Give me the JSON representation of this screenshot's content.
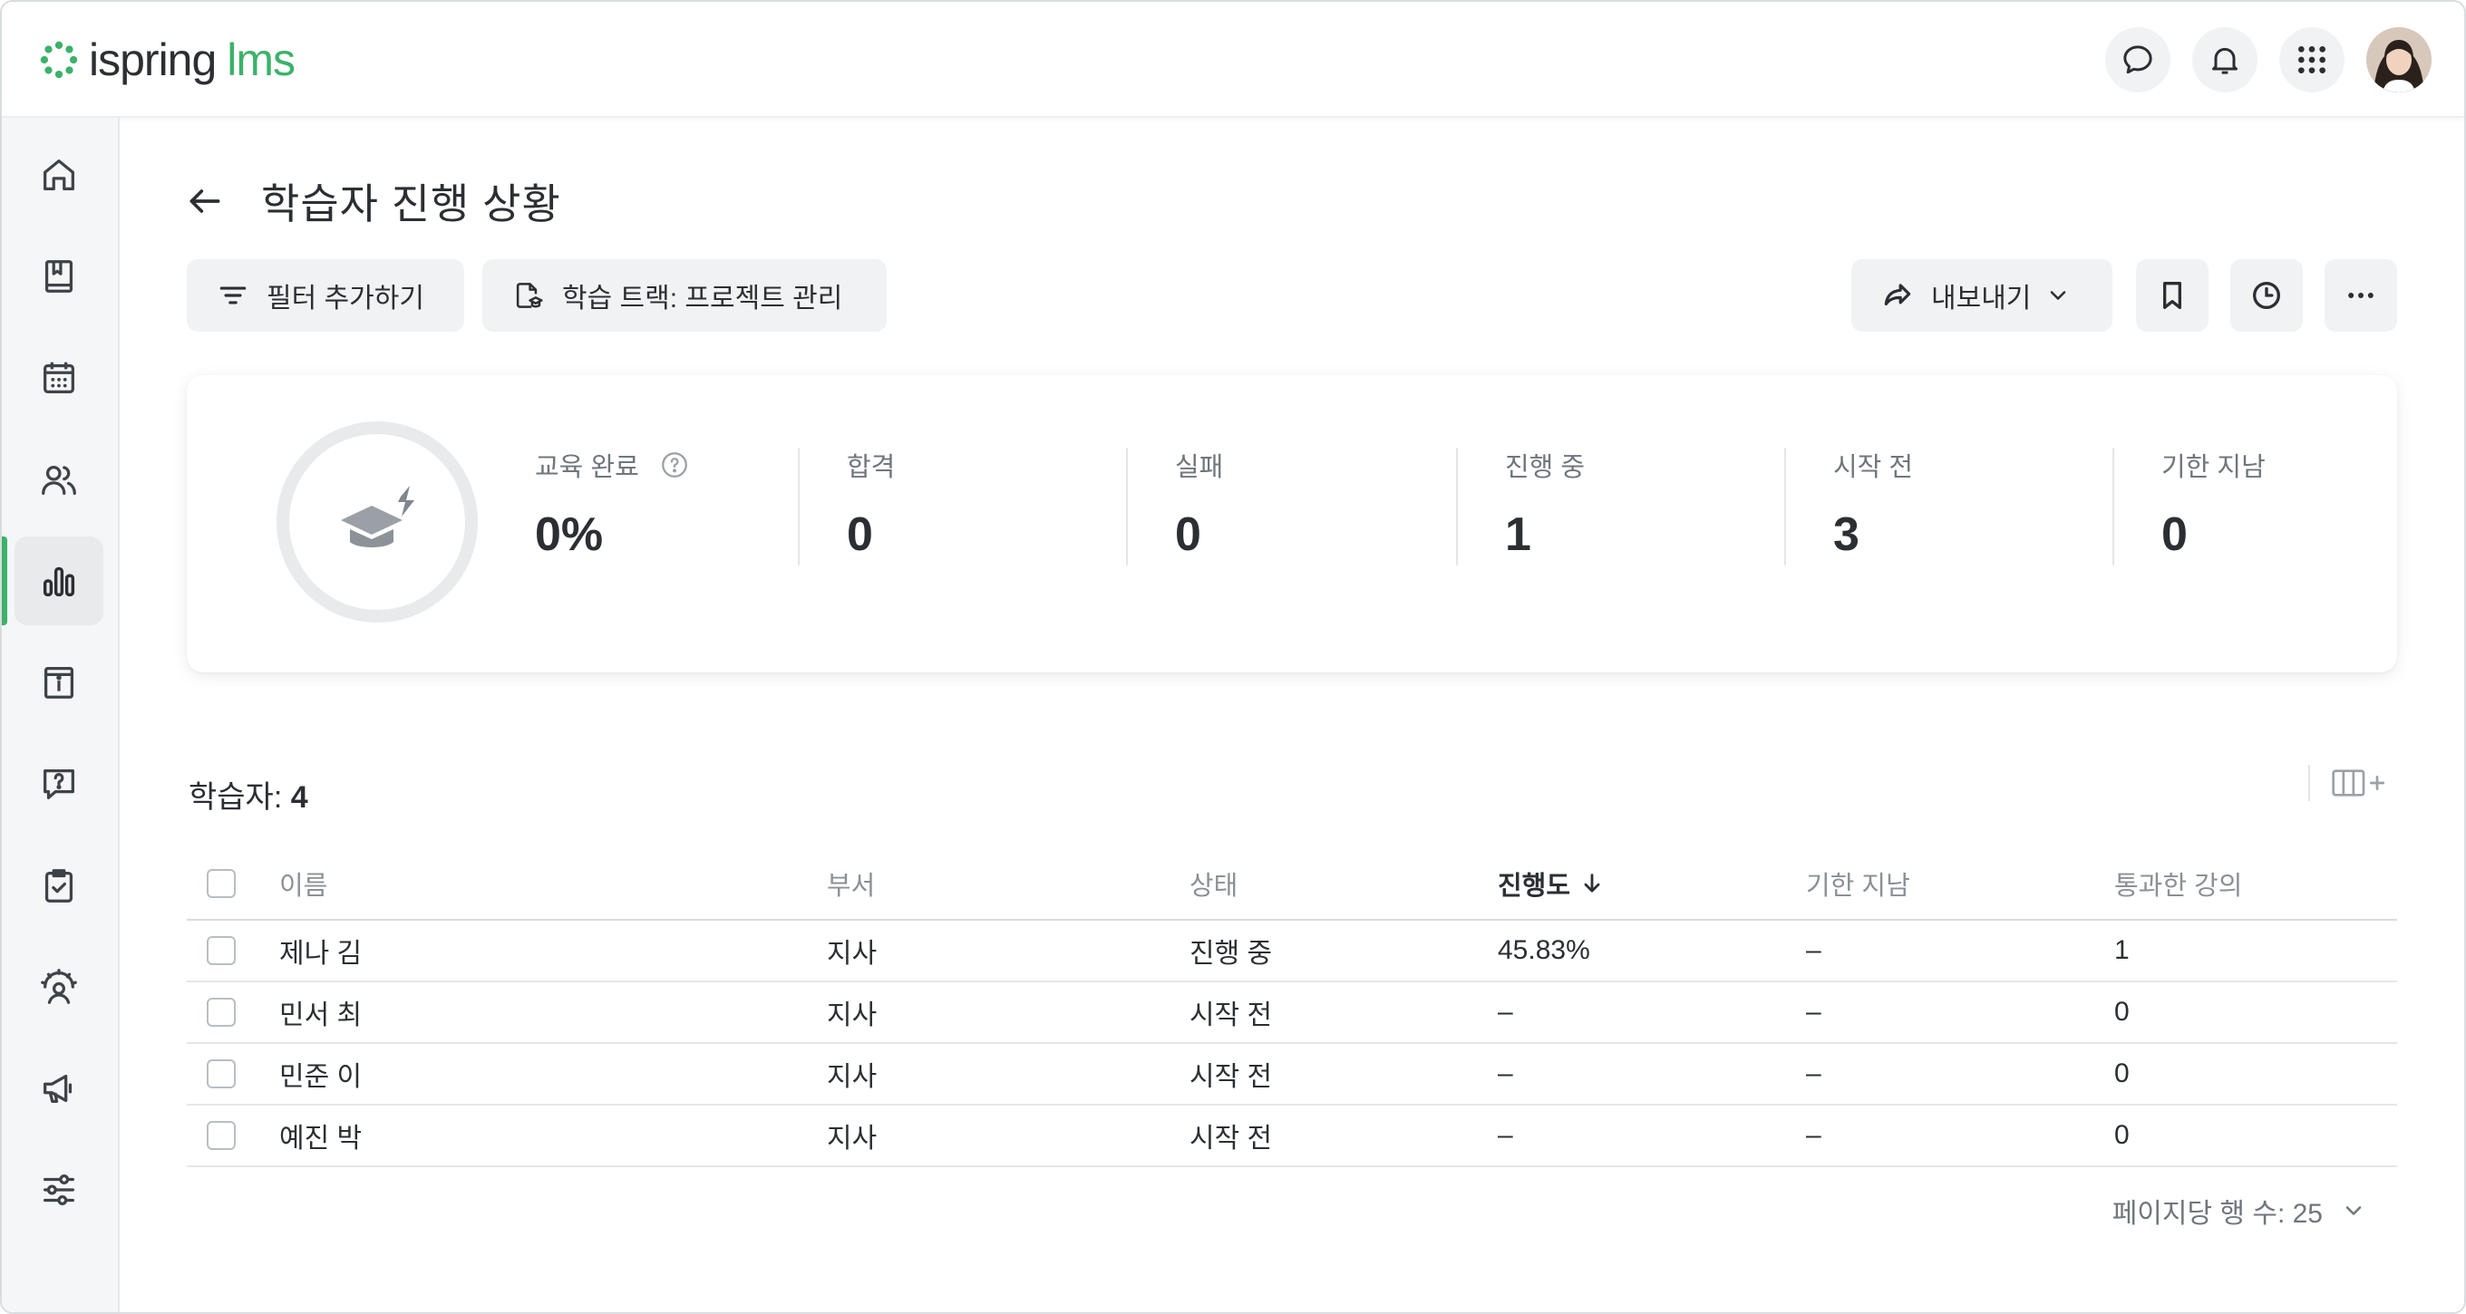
{
  "brand": {
    "name": "ispring",
    "product": "lms",
    "accent": "#3bb26a"
  },
  "topbar": {
    "icons": [
      "chat-icon",
      "bell-icon",
      "apps-grid-icon"
    ],
    "avatar": "user-avatar"
  },
  "sidebar": {
    "items": [
      {
        "icon": "home-icon",
        "active": false
      },
      {
        "icon": "book-icon",
        "active": false
      },
      {
        "icon": "calendar-icon",
        "active": false
      },
      {
        "icon": "users-icon",
        "active": false
      },
      {
        "icon": "bar-chart-icon",
        "active": true
      },
      {
        "icon": "info-board-icon",
        "active": false
      },
      {
        "icon": "question-chat-icon",
        "active": false
      },
      {
        "icon": "clipboard-check-icon",
        "active": false
      },
      {
        "icon": "user-gauge-icon",
        "active": false
      },
      {
        "icon": "megaphone-icon",
        "active": false
      },
      {
        "icon": "sliders-icon",
        "active": false
      }
    ]
  },
  "page": {
    "title": "학습자 진행 상황"
  },
  "toolbar": {
    "filter_label": "필터 추가하기",
    "track_label": "학습 트랙: 프로젝트 관리",
    "export_label": "내보내기"
  },
  "stats": {
    "completion": {
      "label": "교육 완료",
      "value": "0%"
    },
    "items": [
      {
        "label": "합격",
        "value": "0"
      },
      {
        "label": "실패",
        "value": "0"
      },
      {
        "label": "진행 중",
        "value": "1"
      },
      {
        "label": "시작 전",
        "value": "3"
      },
      {
        "label": "기한 지남",
        "value": "0"
      }
    ]
  },
  "learners": {
    "count_label": "학습자: ",
    "count": "4",
    "columns": [
      "이름",
      "부서",
      "상태",
      "진행도",
      "기한 지남",
      "통과한 강의"
    ],
    "rows": [
      {
        "name": "제나 김",
        "dept": "지사",
        "status": "진행 중",
        "progress": "45.83%",
        "overdue": "–",
        "passed": "1"
      },
      {
        "name": "민서 최",
        "dept": "지사",
        "status": "시작 전",
        "progress": "–",
        "overdue": "–",
        "passed": "0"
      },
      {
        "name": "민준 이",
        "dept": "지사",
        "status": "시작 전",
        "progress": "–",
        "overdue": "–",
        "passed": "0"
      },
      {
        "name": "예진 박",
        "dept": "지사",
        "status": "시작 전",
        "progress": "–",
        "overdue": "–",
        "passed": "0"
      }
    ]
  },
  "pager": {
    "rows_per_page": "페이지당 행 수: 25"
  }
}
